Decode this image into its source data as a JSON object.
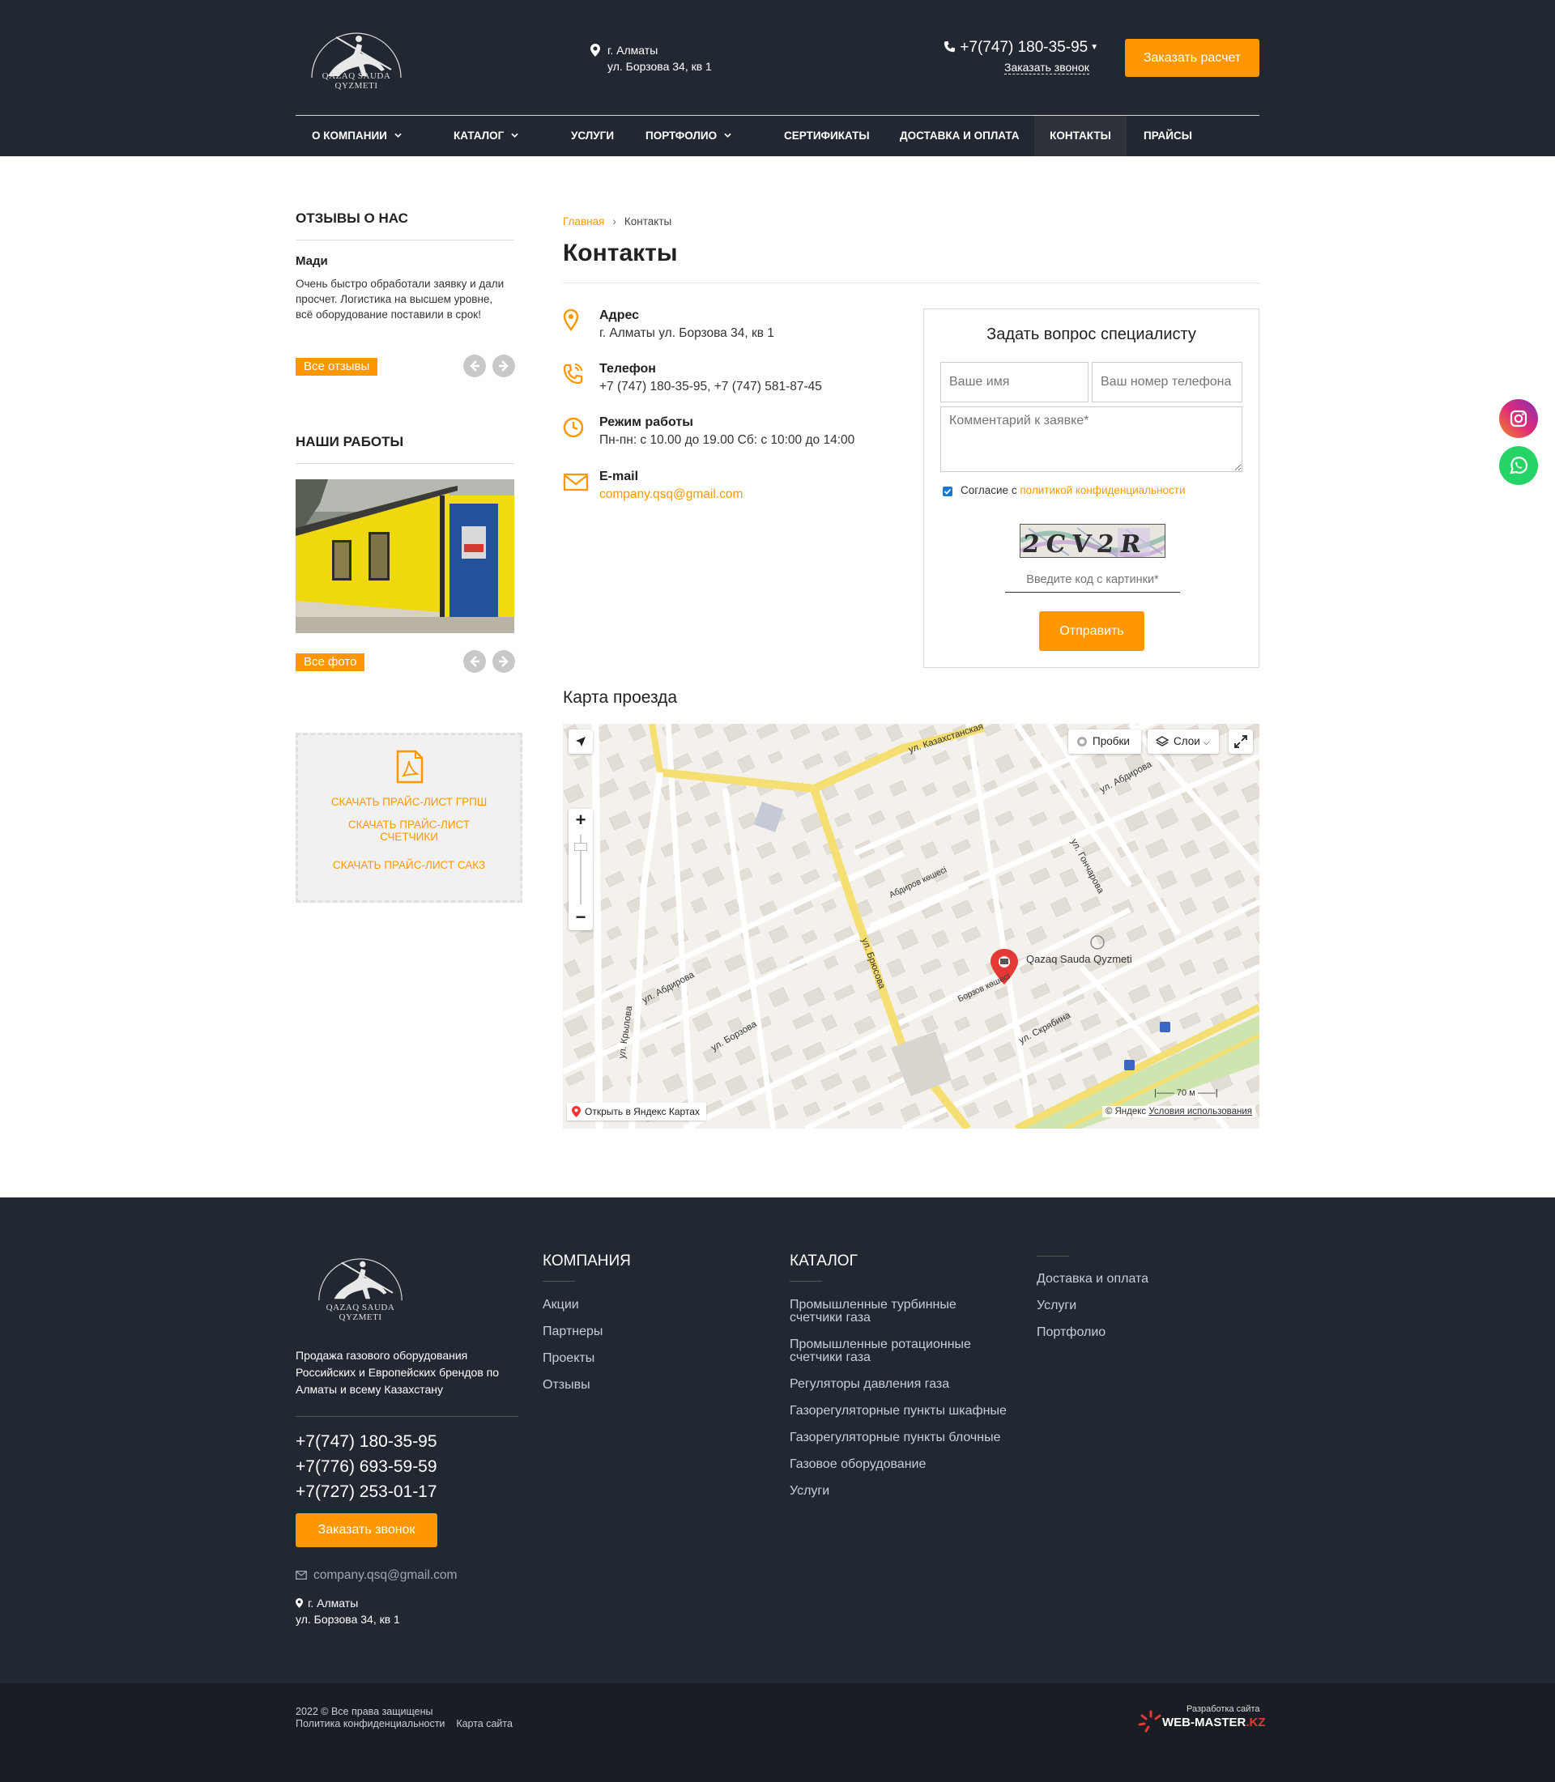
{
  "header": {
    "logo_text": "QAZAQ SAUDA QYZMETI",
    "city": "г. Алматы",
    "street": "ул. Борзова 34, кв 1",
    "phone": "+7(747) 180-35-95",
    "callback": "Заказать звонок",
    "order_button": "Заказать расчет"
  },
  "nav": {
    "items": [
      {
        "label": "О компании",
        "has_dropdown": true
      },
      {
        "label": "Каталог",
        "has_dropdown": true
      },
      {
        "label": "Услуги",
        "has_dropdown": false
      },
      {
        "label": "Портфолио",
        "has_dropdown": true
      },
      {
        "label": "Сертификаты",
        "has_dropdown": false
      },
      {
        "label": "Доставка и оплата",
        "has_dropdown": false
      },
      {
        "label": "Контакты",
        "has_dropdown": false,
        "active": true
      },
      {
        "label": "Прайсы",
        "has_dropdown": false
      }
    ]
  },
  "sidebar": {
    "reviews_title": "Отзывы о нас",
    "review_name": "Мади",
    "review_text": "Очень быстро обработали заявку и дали просчет. Логистика на высшем уровне, всё оборудование поставили в срок!",
    "all_reviews": "Все отзывы",
    "works_title": "Наши работы",
    "all_photos": "Все фото",
    "price_links": [
      "Скачать прайс-лист ГРПШ",
      "Скачать прайс-лист счетчики",
      "Скачать прайс-лист САКЗ"
    ]
  },
  "breadcrumb": {
    "home": "Главная",
    "sep": "›",
    "current": "Контакты"
  },
  "page_title": "Контакты",
  "contacts": {
    "address_label": "Адрес",
    "address_value": "г. Алматы ул. Борзова 34, кв 1",
    "phone_label": "Телефон",
    "phone_value": "+7 (747) 180-35-95, +7 (747) 581-87-45",
    "hours_label": "Режим работы",
    "hours_value": "Пн-пн: с 10.00 до 19.00 Сб: с 10:00 до 14:00",
    "email_label": "E-mail",
    "email_value": "company.qsq@gmail.com"
  },
  "form": {
    "title": "Задать вопрос специалисту",
    "name_placeholder": "Ваше имя",
    "phone_placeholder": "Ваш номер телефона",
    "comment_placeholder": "Комментарий к заявке*",
    "agree_text": "Согласие с",
    "agree_link": "политикой конфиденциальности",
    "captcha_code": "2CV2R",
    "captcha_placeholder": "Введите код с картинки*",
    "submit": "Отправить"
  },
  "map": {
    "title": "Карта проезда",
    "traffic": "Пробки",
    "layers": "Слои",
    "place_name": "Qazaq Sauda Qyzmeti",
    "open_in": "Открыть в Яндекс Картах",
    "copyright": "© Яндекс",
    "terms": "Условия использования",
    "scale": "70 м",
    "streets": [
      "ул. Казахстанская",
      "ул. Абдирова",
      "ул. Брюсова",
      "ул. Гончарова",
      "ул. Борзова",
      "ул. Скрябина",
      "ул. Крылова",
      "Абдиров көшесі",
      "Борзов көшесі"
    ]
  },
  "footer": {
    "logo_text": "QAZAQ SAUDA QYZMETI",
    "description": "Продажа газового оборудования Российских и Европейских брендов по Алматы и всему Казахстану",
    "phones": [
      "+7(747) 180-35-95",
      "+7(776) 693-59-59",
      "+7(727) 253-01-17"
    ],
    "callback": "Заказать звонок",
    "email": "company.qsq@gmail.com",
    "city": "г. Алматы",
    "street": "ул. Борзова 34, кв 1",
    "company_title": "Компания",
    "company_links": [
      "Акции",
      "Партнеры",
      "Проекты",
      "Отзывы"
    ],
    "catalog_title": "Каталог",
    "catalog_links": [
      "Промышленные турбинные счетчики газа",
      "Промышленные ротационные счетчики газа",
      "Регуляторы давления газа",
      "Газорегуляторные пункты шкафные",
      "Газорегуляторные пункты блочные",
      "Газовое оборудование",
      "Услуги"
    ],
    "extra_links": [
      "Доставка и оплата",
      "Услуги",
      "Портфолио"
    ]
  },
  "bottom": {
    "copyright": "2022 © Все права защищены",
    "privacy": "Политика конфиденциальности",
    "sitemap": "Карта сайта",
    "dev_small": "Разработка сайта",
    "dev_name": "WEB-MASTER",
    "dev_tld": ".KZ"
  },
  "colors": {
    "accent": "#ff9800",
    "dark": "#222831",
    "link_blue": "#1976d2"
  }
}
